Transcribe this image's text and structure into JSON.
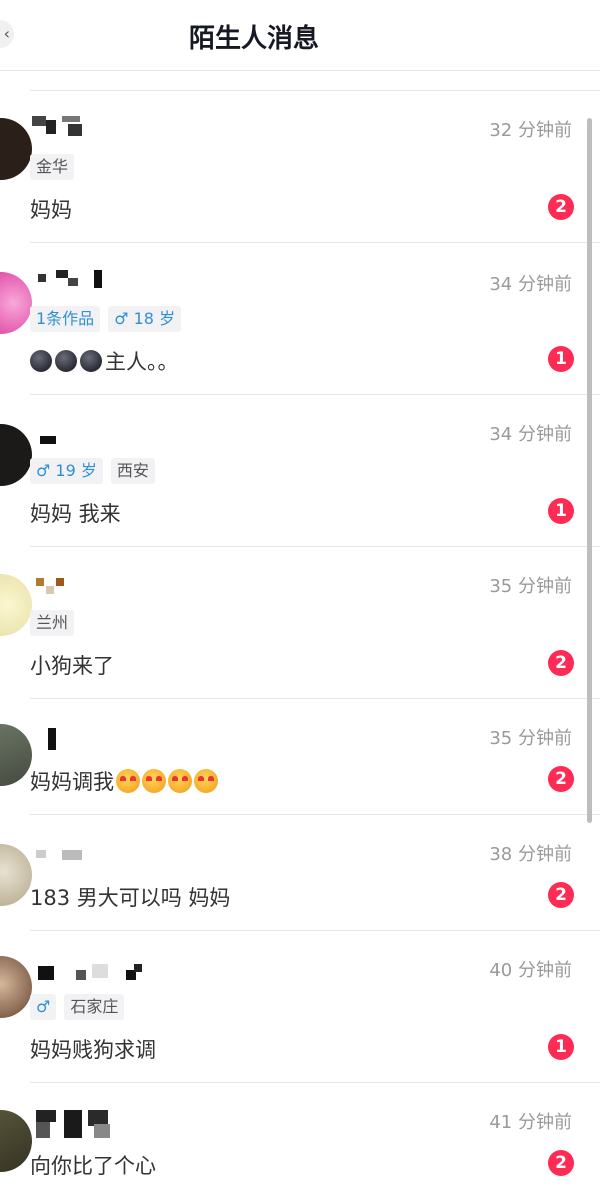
{
  "header": {
    "title": "陌生人消息",
    "back_icon": "chevron-left-icon"
  },
  "conversations": [
    {
      "name": "",
      "time": "32 分钟前",
      "tags": [
        "金华"
      ],
      "message": "妈妈",
      "unread": "2"
    },
    {
      "name": "",
      "time": "34 分钟前",
      "tags": [
        "1条作品",
        "♂ 18 岁"
      ],
      "message": "主人。。",
      "unread": "1"
    },
    {
      "name": "",
      "time": "34 分钟前",
      "tags": [
        "♂ 19 岁",
        "西安"
      ],
      "message": "妈妈 我来",
      "unread": "1"
    },
    {
      "name": "",
      "time": "35 分钟前",
      "tags": [
        "兰州"
      ],
      "message": "小狗来了",
      "unread": "2"
    },
    {
      "name": "",
      "time": "35 分钟前",
      "tags": [],
      "message": "妈妈调我",
      "unread": "2"
    },
    {
      "name": "",
      "time": "38 分钟前",
      "tags": [],
      "message": "183 男大可以吗 妈妈",
      "unread": "2"
    },
    {
      "name": "",
      "time": "40 分钟前",
      "tags": [
        "♂",
        "石家庄"
      ],
      "message": "妈妈贱狗求调",
      "unread": "1"
    },
    {
      "name": "",
      "time": "41 分钟前",
      "tags": [],
      "message": "向你比了个心",
      "unread": "2"
    }
  ],
  "colors": {
    "badge": "#fe2c55",
    "tag_blue": "#2f8fd6",
    "time_gray": "#9a9a9a"
  }
}
